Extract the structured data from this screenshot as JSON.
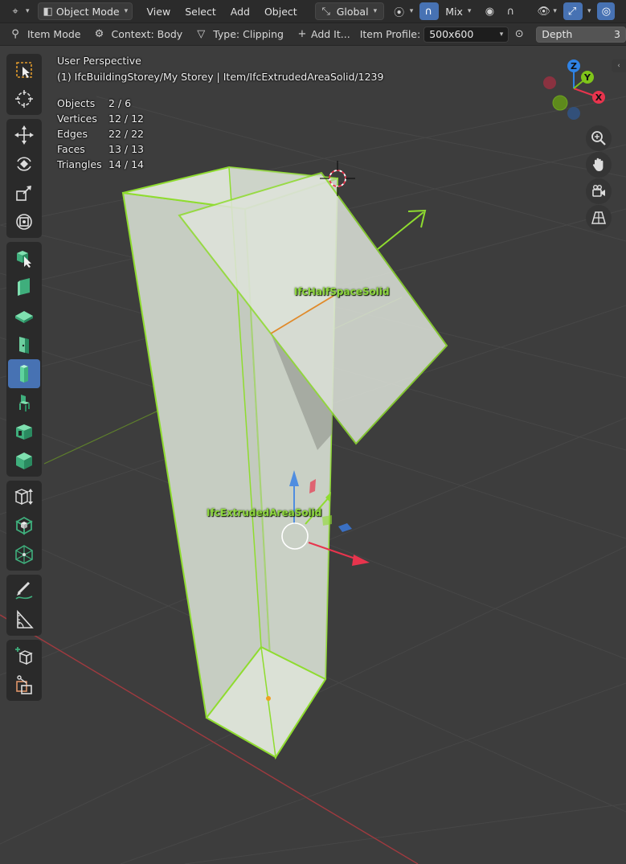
{
  "menubar": {
    "mode": "Object Mode",
    "menus": [
      "View",
      "Select",
      "Add",
      "Object"
    ],
    "orientation": "Global",
    "snap_target": "Mix"
  },
  "tool_header": {
    "item_mode": "Item Mode",
    "context": "Context: Body",
    "type": "Type: Clipping",
    "add_item": "Add It...",
    "item_profile_label": "Item Profile:",
    "item_profile_value": "500x600",
    "depth_label": "Depth",
    "depth_value": "3"
  },
  "viewport": {
    "perspective": "User Perspective",
    "active_object": "(1) IfcBuildingStorey/My Storey | Item/IfcExtrudedAreaSolid/1239",
    "stats": [
      {
        "label": "Objects",
        "value": "2 / 6"
      },
      {
        "label": "Vertices",
        "value": "12 / 12"
      },
      {
        "label": "Edges",
        "value": "22 / 22"
      },
      {
        "label": "Faces",
        "value": "13 / 13"
      },
      {
        "label": "Triangles",
        "value": "14 / 14"
      }
    ],
    "labels": {
      "half_space": "IfcHalfSpaceSolid",
      "extruded": "IfcExtrudedAreaSolid"
    },
    "gizmo": {
      "x": "X",
      "y": "Y",
      "z": "Z"
    }
  },
  "colors": {
    "accent": "#4772b3",
    "selection": "#8fdc2f",
    "axis_x": "#e8344d",
    "axis_y": "#7fc51a",
    "axis_z": "#2f83e6"
  },
  "toolbar": {
    "tools": [
      "select-box-icon",
      "cursor-icon",
      "move-icon",
      "rotate-icon",
      "scale-icon",
      "transform-icon",
      "explore-icon",
      "wall-icon",
      "slab-icon",
      "door-icon",
      "column-icon",
      "furniture-icon",
      "opening-icon",
      "element-icon",
      "space-icon",
      "covering-icon",
      "structural-icon",
      "annotate-icon",
      "measure-icon",
      "add-cube-icon",
      "cut-icon"
    ]
  }
}
